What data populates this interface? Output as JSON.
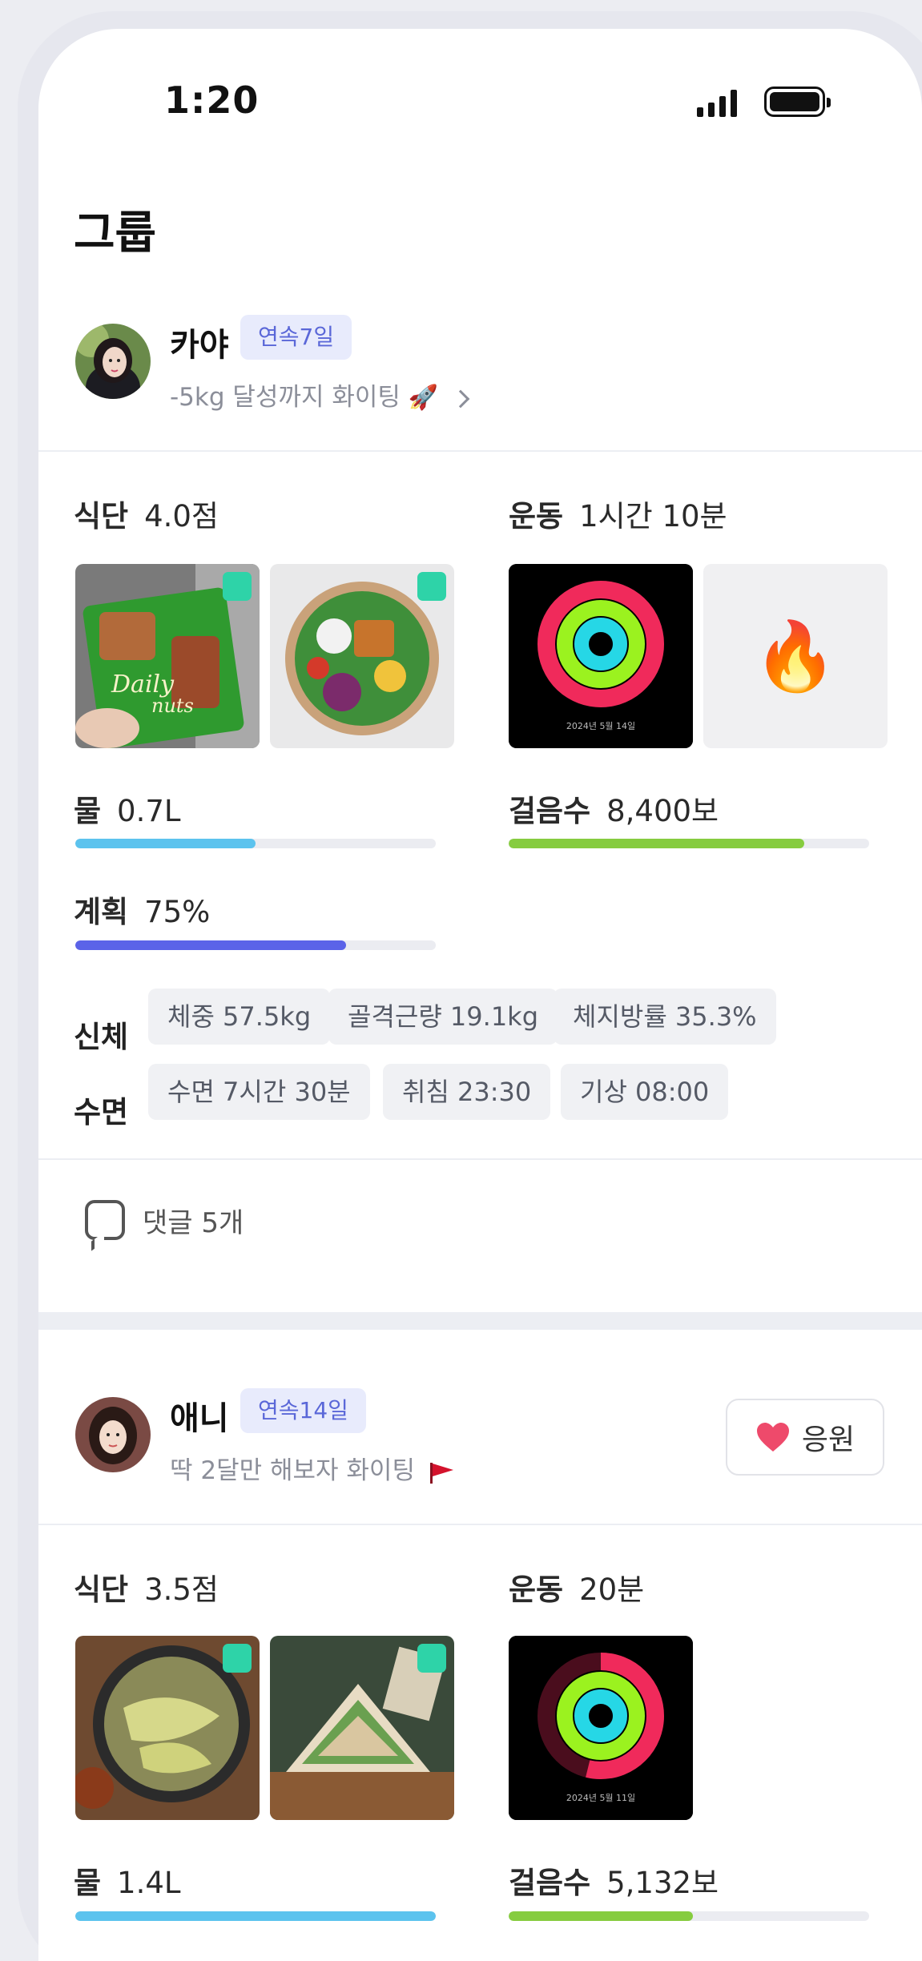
{
  "status_bar": {
    "time": "1:20"
  },
  "page": {
    "title": "그룹"
  },
  "members": [
    {
      "name": "카야",
      "streak": "연속7일",
      "motto": "-5kg 달성까지 화이팅",
      "motto_emoji": "🚀",
      "diet": {
        "label": "식단",
        "value": "4.0점"
      },
      "exercise": {
        "label": "운동",
        "value": "1시간 10분",
        "ring_date": "2024년 5월 14일",
        "extra_emoji": "🔥"
      },
      "water": {
        "label": "물",
        "value": "0.7L",
        "progress": 0.5
      },
      "steps": {
        "label": "걸음수",
        "value": "8,400보",
        "progress": 0.82
      },
      "plan": {
        "label": "계획",
        "value": "75%",
        "progress": 0.75
      },
      "body": {
        "label": "신체",
        "chips": [
          "체중 57.5kg",
          "골격근량 19.1kg",
          "체지방률 35.3%"
        ]
      },
      "sleep": {
        "label": "수면",
        "chips": [
          "수면 7시간 30분",
          "취침 23:30",
          "기상 08:00"
        ]
      },
      "comments": "댓글 5개"
    },
    {
      "name": "애니",
      "streak": "연속14일",
      "motto": "딱 2달만 해보자 화이팅",
      "cheer_button": "응원",
      "diet": {
        "label": "식단",
        "value": "3.5점"
      },
      "exercise": {
        "label": "운동",
        "value": "20분",
        "ring_date": "2024년 5월 11일"
      },
      "water": {
        "label": "물",
        "value": "1.4L",
        "progress": 1.0
      },
      "steps": {
        "label": "걸음수",
        "value": "5,132보",
        "progress": 0.51
      }
    }
  ],
  "colors": {
    "accent": "#5a67d8",
    "water": "#5cc3ee",
    "steps": "#86cc3f",
    "plan": "#5b63e8",
    "check": "#2ed3a8",
    "heart": "#ee4a6b"
  }
}
